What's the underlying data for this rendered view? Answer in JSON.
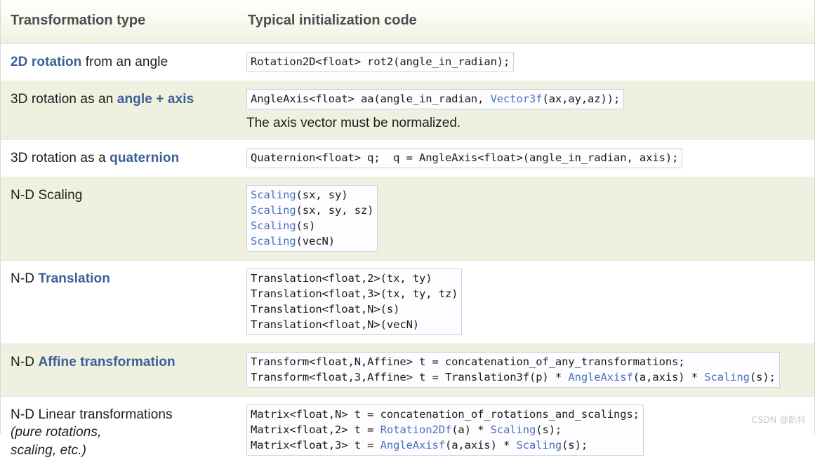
{
  "table": {
    "header": {
      "col_type": "Transformation type",
      "col_code": "Typical initialization code"
    },
    "rows": [
      {
        "type_prefix": "",
        "type_highlight": "2D rotation",
        "type_suffix": " from an angle",
        "type_italic": "",
        "code_lines": [
          [
            {
              "t": "Rotation2D<float> rot2(angle_in_radian);",
              "kw": false
            }
          ]
        ],
        "note": "",
        "shade": "odd"
      },
      {
        "type_prefix": "3D rotation as an ",
        "type_highlight": "angle + axis",
        "type_suffix": "",
        "type_italic": "",
        "code_lines": [
          [
            {
              "t": "AngleAxis<float> aa(angle_in_radian, ",
              "kw": false
            },
            {
              "t": "Vector3f",
              "kw": true
            },
            {
              "t": "(ax,ay,az));",
              "kw": false
            }
          ]
        ],
        "note": "The axis vector must be normalized.",
        "shade": "even"
      },
      {
        "type_prefix": "3D rotation as a ",
        "type_highlight": "quaternion",
        "type_suffix": "",
        "type_italic": "",
        "code_lines": [
          [
            {
              "t": "Quaternion<float> q;  q = AngleAxis<float>(angle_in_radian, axis);",
              "kw": false
            }
          ]
        ],
        "note": "",
        "shade": "odd"
      },
      {
        "type_prefix": "N-D Scaling",
        "type_highlight": "",
        "type_suffix": "",
        "type_italic": "",
        "code_lines": [
          [
            {
              "t": "Scaling",
              "kw": true
            },
            {
              "t": "(sx, sy)",
              "kw": false
            }
          ],
          [
            {
              "t": "Scaling",
              "kw": true
            },
            {
              "t": "(sx, sy, sz)",
              "kw": false
            }
          ],
          [
            {
              "t": "Scaling",
              "kw": true
            },
            {
              "t": "(s)",
              "kw": false
            }
          ],
          [
            {
              "t": "Scaling",
              "kw": true
            },
            {
              "t": "(vecN)",
              "kw": false
            }
          ]
        ],
        "note": "",
        "shade": "even"
      },
      {
        "type_prefix": "N-D ",
        "type_highlight": "Translation",
        "type_suffix": "",
        "type_italic": "",
        "code_lines": [
          [
            {
              "t": "Translation<float,2>(tx, ty)",
              "kw": false
            }
          ],
          [
            {
              "t": "Translation<float,3>(tx, ty, tz)",
              "kw": false
            }
          ],
          [
            {
              "t": "Translation<float,N>(s)",
              "kw": false
            }
          ],
          [
            {
              "t": "Translation<float,N>(vecN)",
              "kw": false
            }
          ]
        ],
        "note": "",
        "shade": "odd"
      },
      {
        "type_prefix": "N-D ",
        "type_highlight": "Affine transformation",
        "type_suffix": "",
        "type_italic": "",
        "code_lines": [
          [
            {
              "t": "Transform<float,N,Affine> t = concatenation_of_any_transformations;",
              "kw": false
            }
          ],
          [
            {
              "t": "Transform<float,3,Affine> t = Translation3f(p) * ",
              "kw": false
            },
            {
              "t": "AngleAxisf",
              "kw": true
            },
            {
              "t": "(a,axis) * ",
              "kw": false
            },
            {
              "t": "Scaling",
              "kw": true
            },
            {
              "t": "(s);",
              "kw": false
            }
          ]
        ],
        "note": "",
        "shade": "even"
      },
      {
        "type_prefix": "N-D Linear transformations",
        "type_highlight": "",
        "type_suffix": "",
        "type_italic": "(pure rotations,\nscaling, etc.)",
        "code_lines": [
          [
            {
              "t": "Matrix<float,N> t = concatenation_of_rotations_and_scalings;",
              "kw": false
            }
          ],
          [
            {
              "t": "Matrix<float,2> t = ",
              "kw": false
            },
            {
              "t": "Rotation2Df",
              "kw": true
            },
            {
              "t": "(a) * ",
              "kw": false
            },
            {
              "t": "Scaling",
              "kw": true
            },
            {
              "t": "(s);",
              "kw": false
            }
          ],
          [
            {
              "t": "Matrix<float,3> t = ",
              "kw": false
            },
            {
              "t": "AngleAxisf",
              "kw": true
            },
            {
              "t": "(a,axis) * ",
              "kw": false
            },
            {
              "t": "Scaling",
              "kw": true
            },
            {
              "t": "(s);",
              "kw": false
            }
          ]
        ],
        "note": "",
        "shade": "odd"
      }
    ]
  },
  "watermark": "CSDN @趴抖",
  "colors": {
    "highlight_blue": "#3a5f96",
    "code_keyword_blue": "#4a6fc0",
    "row_shade": "#f0f0e1",
    "header_text": "#4d4d4d"
  }
}
